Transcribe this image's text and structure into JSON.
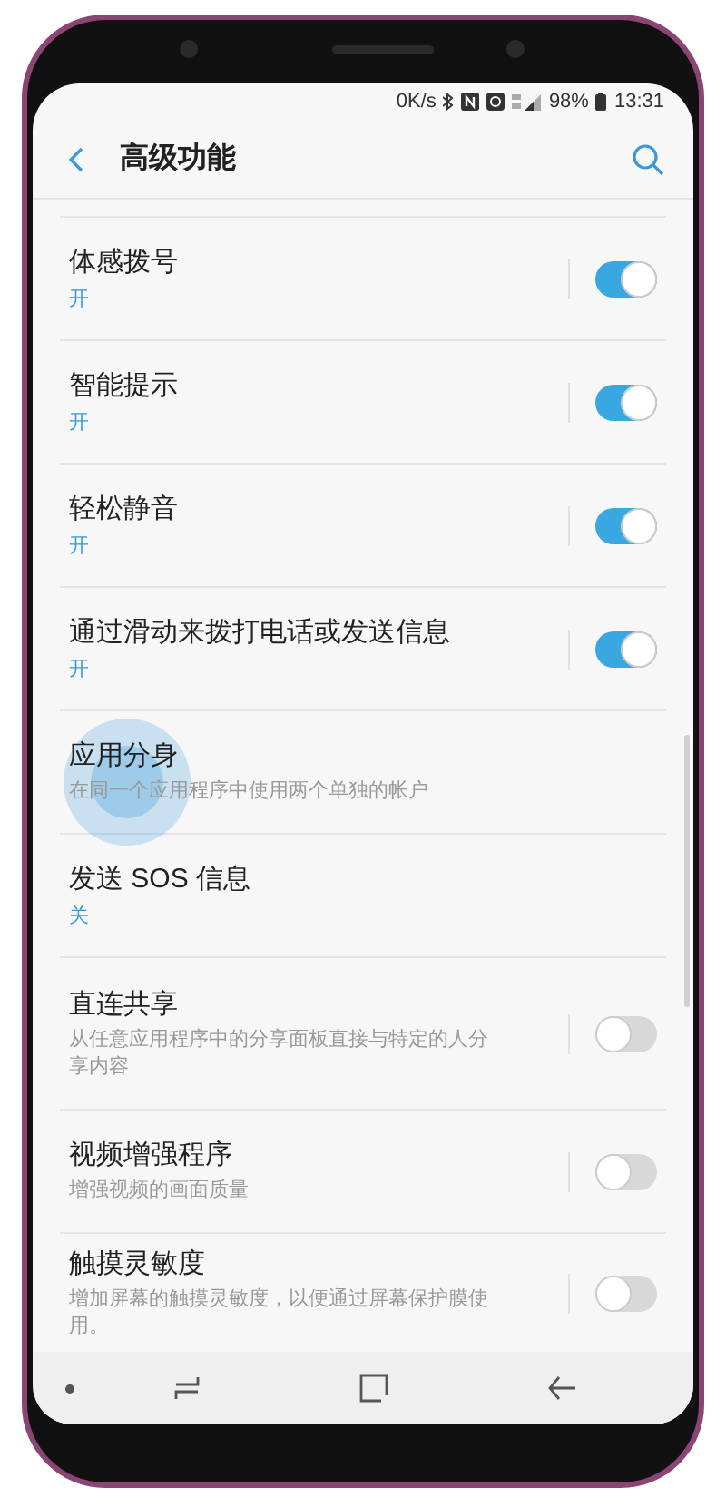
{
  "status_bar": {
    "speed": "0K/s",
    "battery": "98%",
    "time": "13:31"
  },
  "header": {
    "title": "高级功能"
  },
  "settings": [
    {
      "kind": "switch",
      "title": "体感拨号",
      "status": "开",
      "on": true
    },
    {
      "kind": "switch",
      "title": "智能提示",
      "status": "开",
      "on": true
    },
    {
      "kind": "switch",
      "title": "轻松静音",
      "status": "开",
      "on": true
    },
    {
      "kind": "switch",
      "title": "通过滑动来拨打电话或发送信息",
      "status": "开",
      "on": true
    },
    {
      "kind": "plain",
      "title": "应用分身",
      "description": "在同一个应用程序中使用两个单独的帐户",
      "touched": true
    },
    {
      "kind": "plain",
      "title": "发送 SOS 信息",
      "status": "关",
      "touched": false
    },
    {
      "kind": "switch",
      "title": "直连共享",
      "description": "从任意应用程序中的分享面板直接与特定的人分享内容",
      "on": false
    },
    {
      "kind": "switch",
      "title": "视频增强程序",
      "description": "增强视频的画面质量",
      "on": false
    },
    {
      "kind": "switch",
      "title": "触摸灵敏度",
      "description": "增加屏幕的触摸灵敏度，以便通过屏幕保护膜使用。",
      "on": false
    }
  ]
}
